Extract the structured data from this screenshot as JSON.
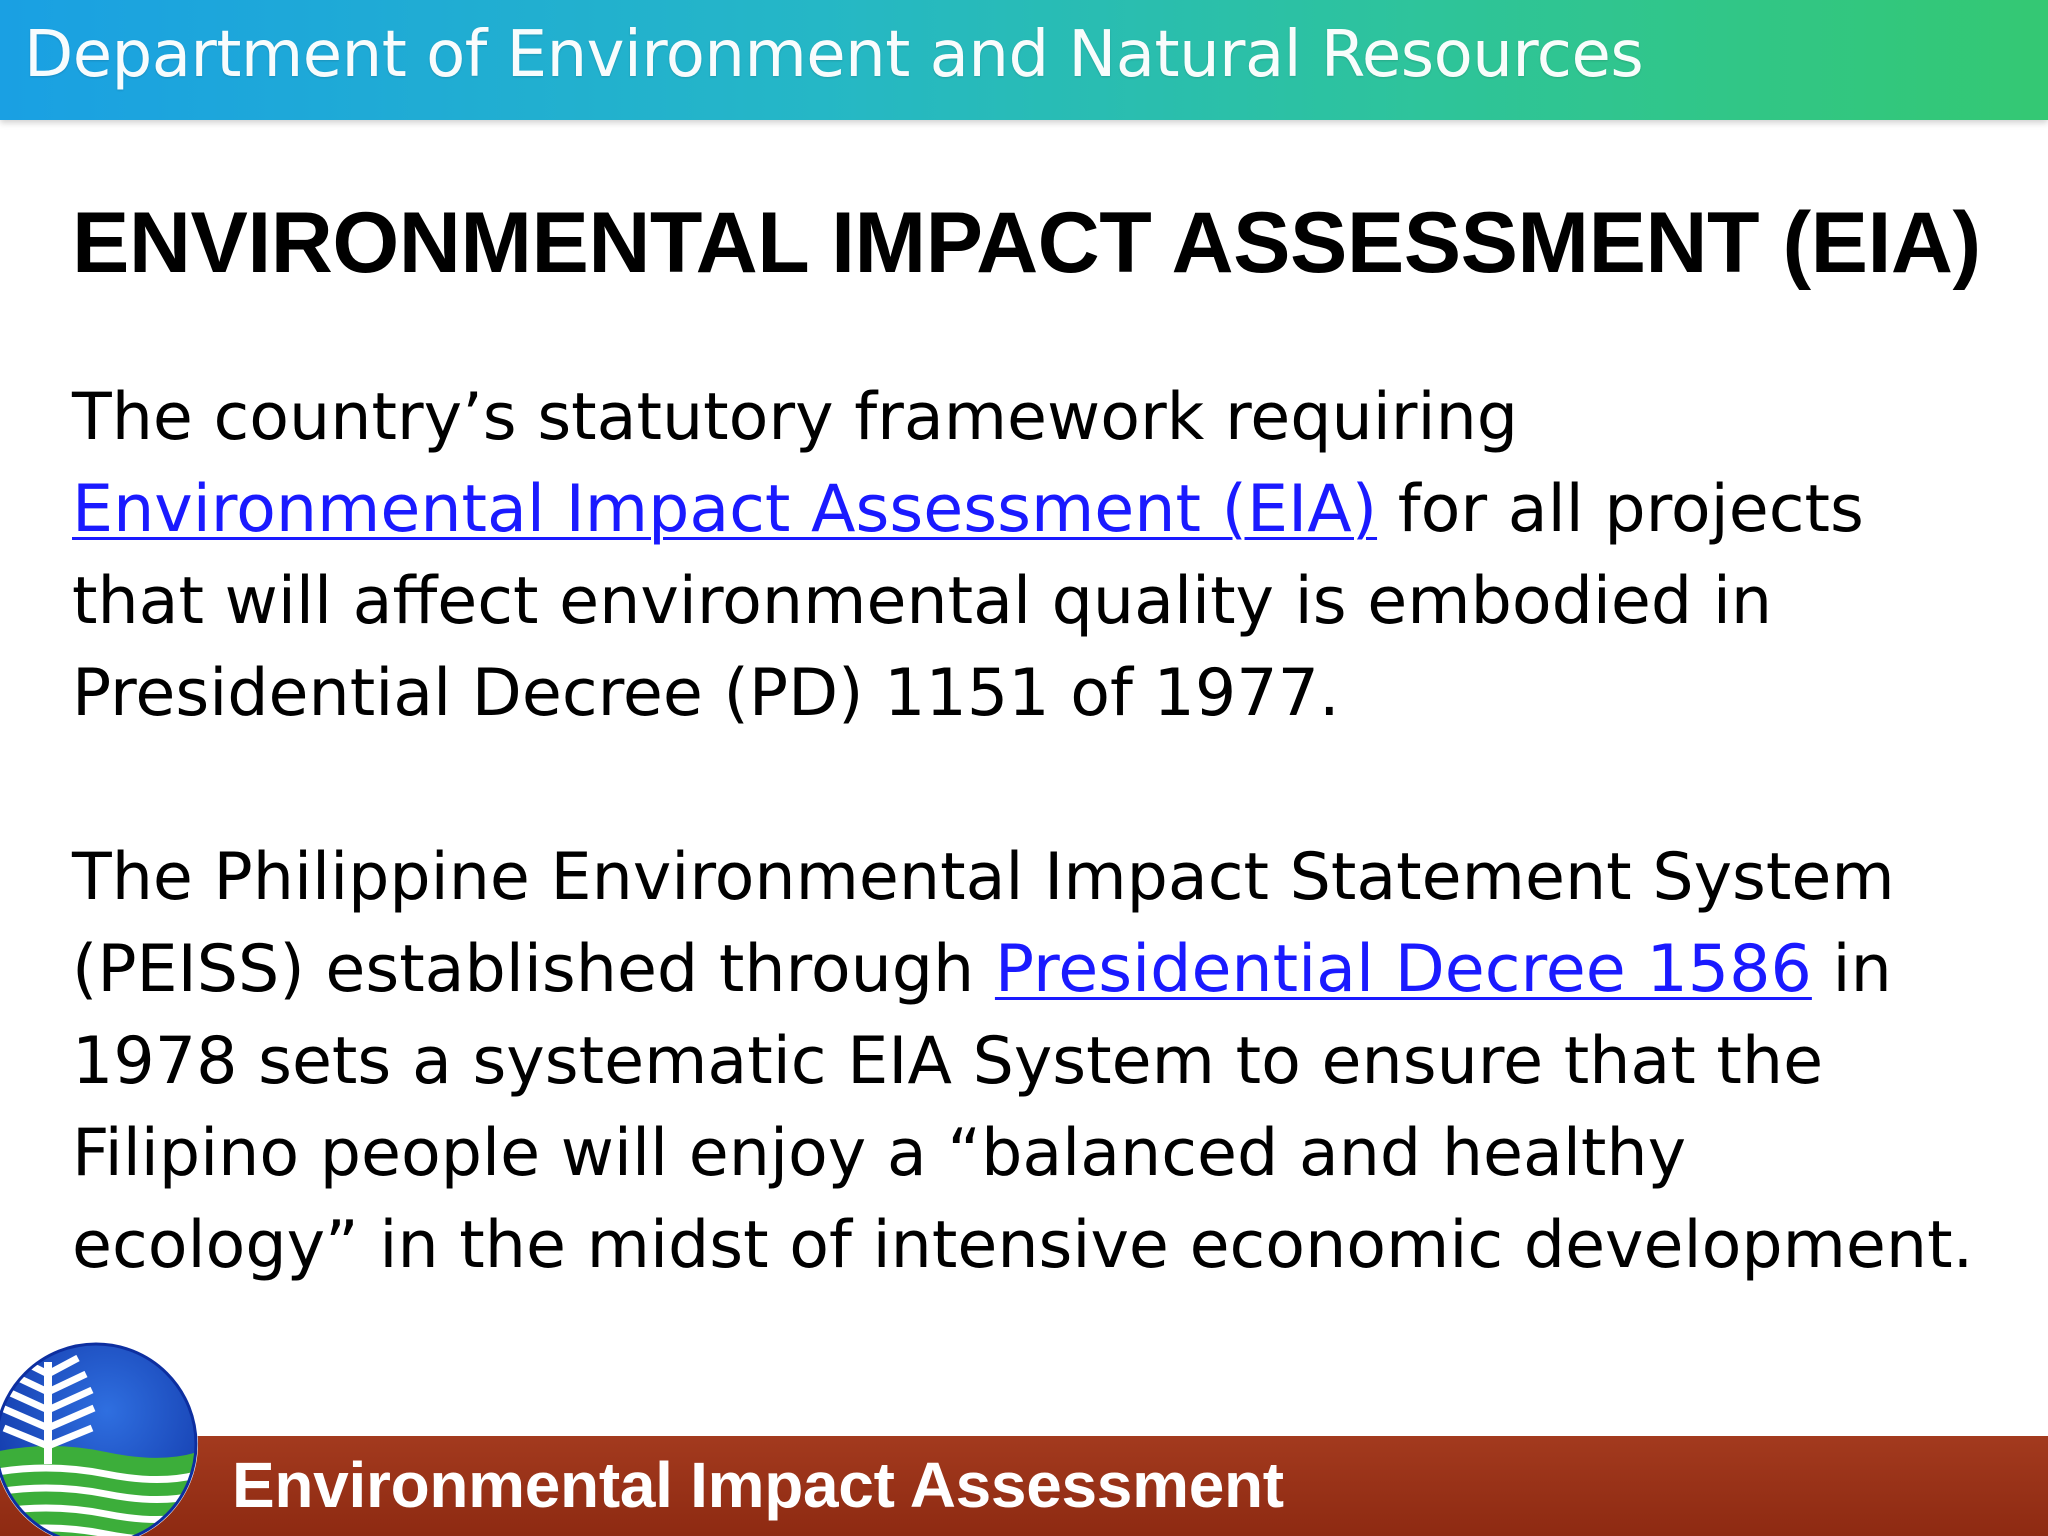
{
  "header": {
    "banner_text": "Department of Environment and Natural Resources",
    "colors": {
      "start": "#1aa0e3",
      "end": "#34c873"
    }
  },
  "slide": {
    "title": "ENVIRONMENTAL IMPACT ASSESSMENT (EIA)",
    "paragraph_1": {
      "before_link": "The country’s statutory framework requiring ",
      "link_text": "Environmental Impact Assessment (EIA)",
      "after_link": " for all projects that will affect environmental quality is embodied in Presidential Decree (PD) 1151 of 1977."
    },
    "paragraph_2": {
      "before_link": "The Philippine Environmental Impact Statement System (PEISS) established through ",
      "link_text": "Presidential Decree 1586",
      "after_link": " in 1978 sets a systematic EIA System to ensure that the Filipino people will enjoy a “balanced and healthy ecology” in the midst of intensive economic development."
    },
    "link_color": "#1a1aff"
  },
  "footer": {
    "banner_text": "Environmental Impact Assessment",
    "color": "#8e2a12",
    "logo_icon": "denr-logo-icon"
  }
}
